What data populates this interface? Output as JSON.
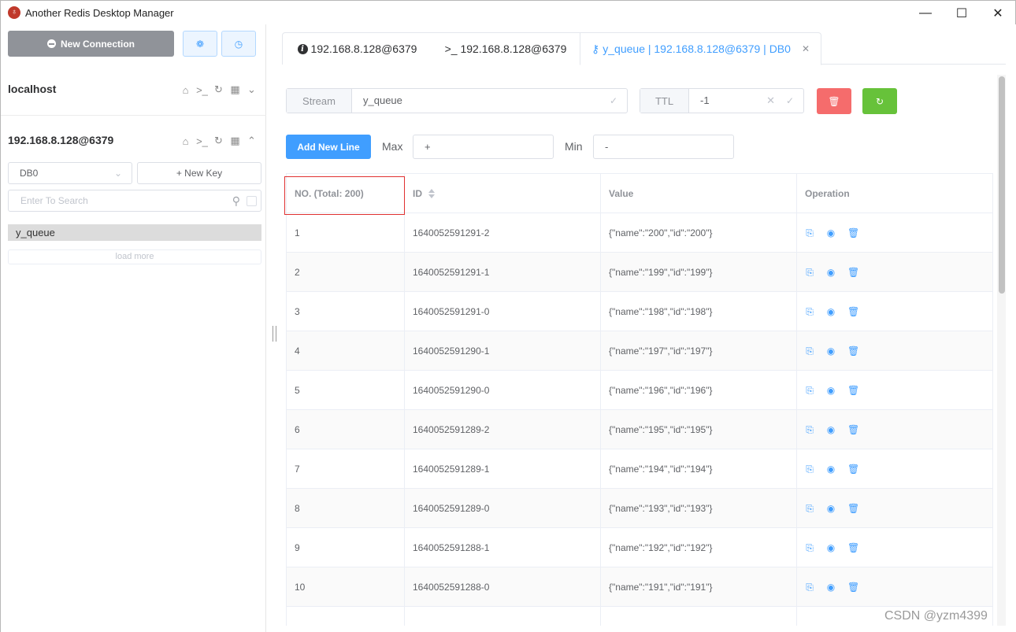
{
  "window": {
    "title": "Another Redis Desktop Manager",
    "minimize": "—",
    "maximize": "☐",
    "close": "✕"
  },
  "sidebar": {
    "new_connection_label": "New Connection",
    "connections": [
      {
        "name": "localhost",
        "expanded": false
      },
      {
        "name": "192.168.8.128@6379",
        "expanded": true
      }
    ],
    "db_select": {
      "value": "DB0"
    },
    "new_key_label": "+ New Key",
    "search_placeholder": "Enter To Search",
    "keys": [
      "y_queue"
    ],
    "load_more_label": "load more"
  },
  "tabs": [
    {
      "label": "192.168.8.128@6379",
      "icon": "info-icon"
    },
    {
      "label": ">_ 192.168.8.128@6379",
      "icon": "terminal-icon"
    },
    {
      "label": "y_queue | 192.168.8.128@6379 | DB0",
      "icon": "key-icon",
      "active": true
    }
  ],
  "key_panel": {
    "type_label": "Stream",
    "key_name": "y_queue",
    "ttl_label": "TTL",
    "ttl_value": "-1",
    "add_line_label": "Add New Line",
    "max_label": "Max",
    "max_value": "+",
    "min_label": "Min",
    "min_value": "-"
  },
  "table": {
    "headers": [
      "NO. (Total: 200)",
      "ID",
      "Value",
      "Operation"
    ],
    "rows": [
      {
        "no": "1",
        "id": "1640052591291-2",
        "value": "{\"name\":\"200\",\"id\":\"200\"}"
      },
      {
        "no": "2",
        "id": "1640052591291-1",
        "value": "{\"name\":\"199\",\"id\":\"199\"}"
      },
      {
        "no": "3",
        "id": "1640052591291-0",
        "value": "{\"name\":\"198\",\"id\":\"198\"}"
      },
      {
        "no": "4",
        "id": "1640052591290-1",
        "value": "{\"name\":\"197\",\"id\":\"197\"}"
      },
      {
        "no": "5",
        "id": "1640052591290-0",
        "value": "{\"name\":\"196\",\"id\":\"196\"}"
      },
      {
        "no": "6",
        "id": "1640052591289-2",
        "value": "{\"name\":\"195\",\"id\":\"195\"}"
      },
      {
        "no": "7",
        "id": "1640052591289-1",
        "value": "{\"name\":\"194\",\"id\":\"194\"}"
      },
      {
        "no": "8",
        "id": "1640052591289-0",
        "value": "{\"name\":\"193\",\"id\":\"193\"}"
      },
      {
        "no": "9",
        "id": "1640052591288-1",
        "value": "{\"name\":\"192\",\"id\":\"192\"}"
      },
      {
        "no": "10",
        "id": "1640052591288-0",
        "value": "{\"name\":\"191\",\"id\":\"191\"}"
      },
      {
        "no": "",
        "id": "",
        "value": ""
      }
    ]
  },
  "watermark": "CSDN @yzm4399",
  "colors": {
    "primary": "#409eff",
    "danger": "#f56c6c",
    "success": "#67c23a",
    "info": "#909399",
    "highlight": "#e03131"
  }
}
